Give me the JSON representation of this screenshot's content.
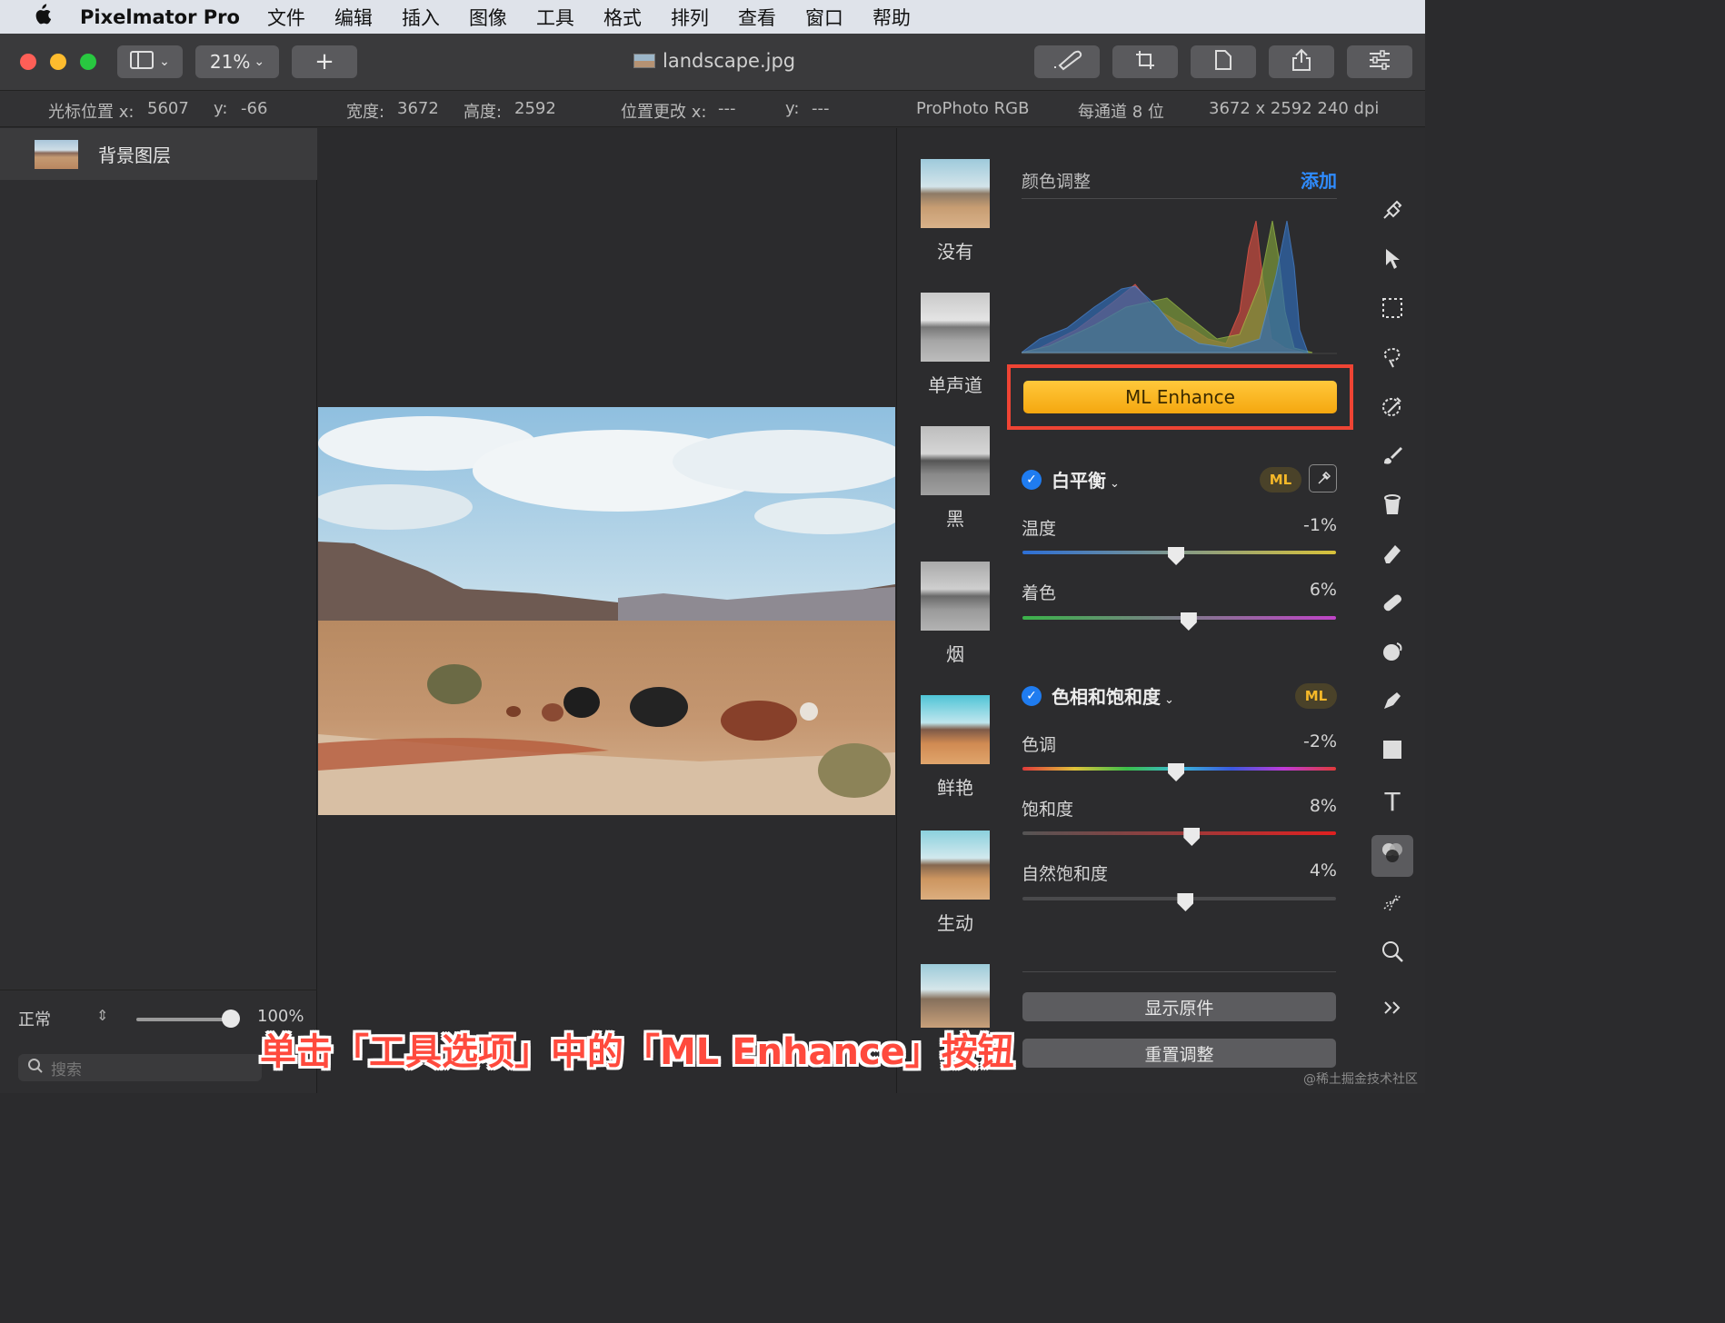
{
  "menubar": {
    "apple_icon": "apple-icon",
    "app_name": "Pixelmator Pro",
    "items": [
      "文件",
      "编辑",
      "插入",
      "图像",
      "工具",
      "格式",
      "排列",
      "查看",
      "窗口",
      "帮助"
    ]
  },
  "toolbar": {
    "zoom": "21%",
    "add_symbol": "+",
    "title": "landscape.jpg"
  },
  "infobar": {
    "cursor_x_label": "光标位置 x:",
    "cursor_x": "5607",
    "cursor_y_label": "y:",
    "cursor_y": "-66",
    "width_label": "宽度:",
    "width": "3672",
    "height_label": "高度:",
    "height": "2592",
    "pos_x_label": "位置更改 x:",
    "pos_x": "---",
    "pos_y_label": "y:",
    "pos_y": "---",
    "color_profile": "ProPhoto RGB",
    "bit_depth": "每通道 8 位",
    "dimensions": "3672 x 2592 240 dpi"
  },
  "layers": {
    "items": [
      {
        "name": "背景图层"
      }
    ],
    "blend_mode": "正常",
    "opacity": "100%",
    "opacity_fraction": 1.0,
    "search_placeholder": "搜索"
  },
  "presets": [
    {
      "label": "没有"
    },
    {
      "label": "单声道"
    },
    {
      "label": "黑"
    },
    {
      "label": "烟"
    },
    {
      "label": "鲜艳"
    },
    {
      "label": "生动"
    }
  ],
  "adjustments": {
    "title": "颜色调整",
    "add": "添加",
    "ml_enhance": "ML Enhance",
    "white_balance": {
      "title": "白平衡",
      "ml": "ML",
      "temperature": {
        "label": "温度",
        "value": "-1%",
        "position": 0.49
      },
      "tint": {
        "label": "着色",
        "value": "6%",
        "position": 0.53
      }
    },
    "hue_saturation": {
      "title": "色相和饱和度",
      "ml": "ML",
      "hue": {
        "label": "色调",
        "value": "-2%",
        "position": 0.49
      },
      "saturation": {
        "label": "饱和度",
        "value": "8%",
        "position": 0.54
      },
      "vibrance": {
        "label": "自然饱和度",
        "value": "4%",
        "position": 0.52
      }
    },
    "show_original": "显示原件",
    "reset": "重置调整"
  },
  "tools": [
    "paint-bucket-style-icon",
    "arrow-icon",
    "rect-select-icon",
    "lasso-icon",
    "color-picker-icon",
    "brush-icon",
    "fill-icon",
    "eraser-icon",
    "bandage-icon",
    "clone-icon",
    "pen-icon",
    "shape-icon",
    "text-icon",
    "color-adjust-icon",
    "effects-icon",
    "zoom-icon",
    "more-icon"
  ],
  "caption": "单击「工具选项」中的「ML Enhance」按钮",
  "watermark": "@稀土掘金技术社区"
}
